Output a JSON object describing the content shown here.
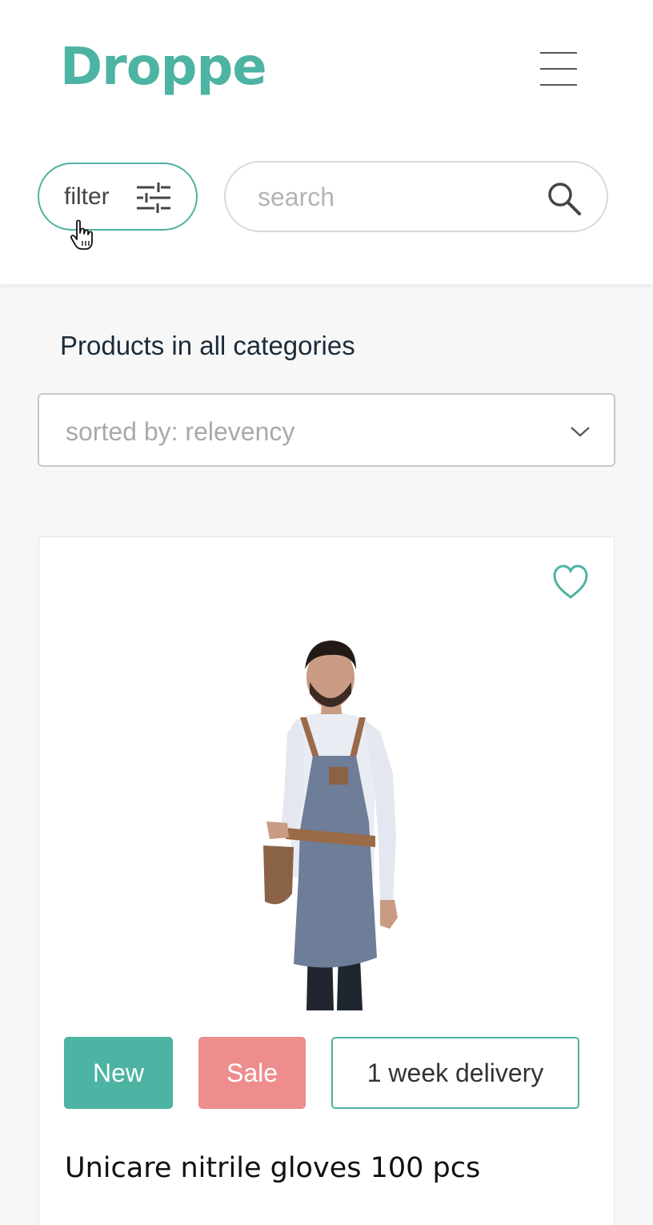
{
  "header": {
    "logo_text": "Droppe",
    "menu_icon": "hamburger-menu-icon"
  },
  "filter": {
    "label": "filter",
    "icon": "sliders-icon"
  },
  "search": {
    "placeholder": "search",
    "value": "",
    "icon": "search-icon"
  },
  "section": {
    "title": "Products in all categories"
  },
  "sort": {
    "selected": "sorted by: relevency",
    "icon": "chevron-down-icon"
  },
  "product": {
    "favorite_icon": "heart-icon",
    "image": "apron-product-photo",
    "badges": {
      "new": "New",
      "sale": "Sale",
      "delivery": "1 week delivery"
    },
    "title": "Unicare nitrile gloves 100 pcs"
  },
  "colors": {
    "brand": "#4db3a2",
    "sale": "#ee8d8d",
    "heading": "#1c2b3a",
    "placeholder": "#b4b4b4"
  }
}
